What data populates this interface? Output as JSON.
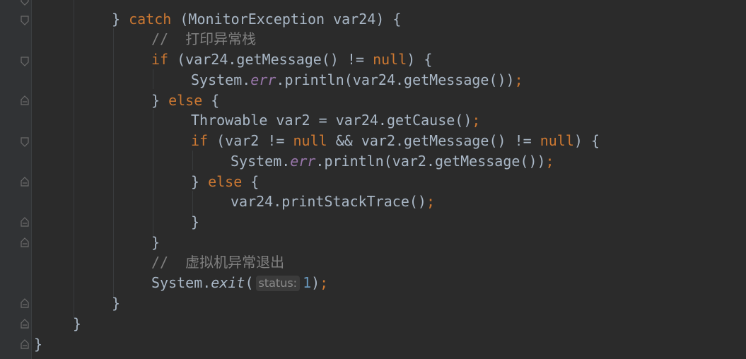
{
  "editor": {
    "lines": {
      "l1": {
        "close_brace": "}",
        "catch_kw": "catch",
        "open_paren": " (",
        "exception_type": "MonitorException",
        "var": " var24",
        "close": ") {"
      },
      "l2": {
        "comment": "//  打印异常栈"
      },
      "l3": {
        "if_kw": "if",
        "cond_a": " (var24.getMessage() != ",
        "null_kw": "null",
        "cond_b": ") {"
      },
      "l4": {
        "system": "System.",
        "err": "err",
        "call": ".println(var24.getMessage())",
        "semi": ";"
      },
      "l5": {
        "close_brace": "} ",
        "else_kw": "else",
        "open": " {"
      },
      "l6": {
        "decl": "Throwable var2 = var24.getCause()",
        "semi": ";"
      },
      "l7": {
        "if_kw": "if",
        "cond_a": " (var2 != ",
        "null_kw1": "null",
        "cond_b": " && var2.getMessage() != ",
        "null_kw2": "null",
        "cond_c": ") {"
      },
      "l8": {
        "system": "System.",
        "err": "err",
        "call": ".println(var2.getMessage())",
        "semi": ";"
      },
      "l9": {
        "close_brace": "} ",
        "else_kw": "else",
        "open": " {"
      },
      "l10": {
        "call": "var24.printStackTrace()",
        "semi": ";"
      },
      "l11": {
        "close_brace": "}"
      },
      "l12": {
        "close_brace": "}"
      },
      "l13": {
        "comment": "//  虚拟机异常退出"
      },
      "l14": {
        "system": "System.",
        "exit": "exit",
        "open": "(",
        "hint": "status:",
        "arg": "1",
        "close": ")",
        "semi": ";"
      },
      "l15": {
        "close_brace": "}"
      },
      "l16": {
        "close_brace": "}"
      },
      "l17": {
        "close_brace": "}"
      }
    }
  },
  "colors": {
    "background": "#2b2b2b",
    "gutter": "#313335",
    "default_text": "#a9b7c6",
    "keyword": "#cc7832",
    "field": "#9876aa",
    "comment": "#808080",
    "number": "#6897bb"
  },
  "gutter_icons": [
    "fold-end-icon",
    "fold-start-icon",
    "fold-start-icon",
    "fold-end-icon",
    "fold-start-icon",
    "fold-end-icon",
    "fold-end-icon",
    "fold-end-icon",
    "fold-end-icon",
    "fold-end-icon",
    "fold-end-icon"
  ]
}
